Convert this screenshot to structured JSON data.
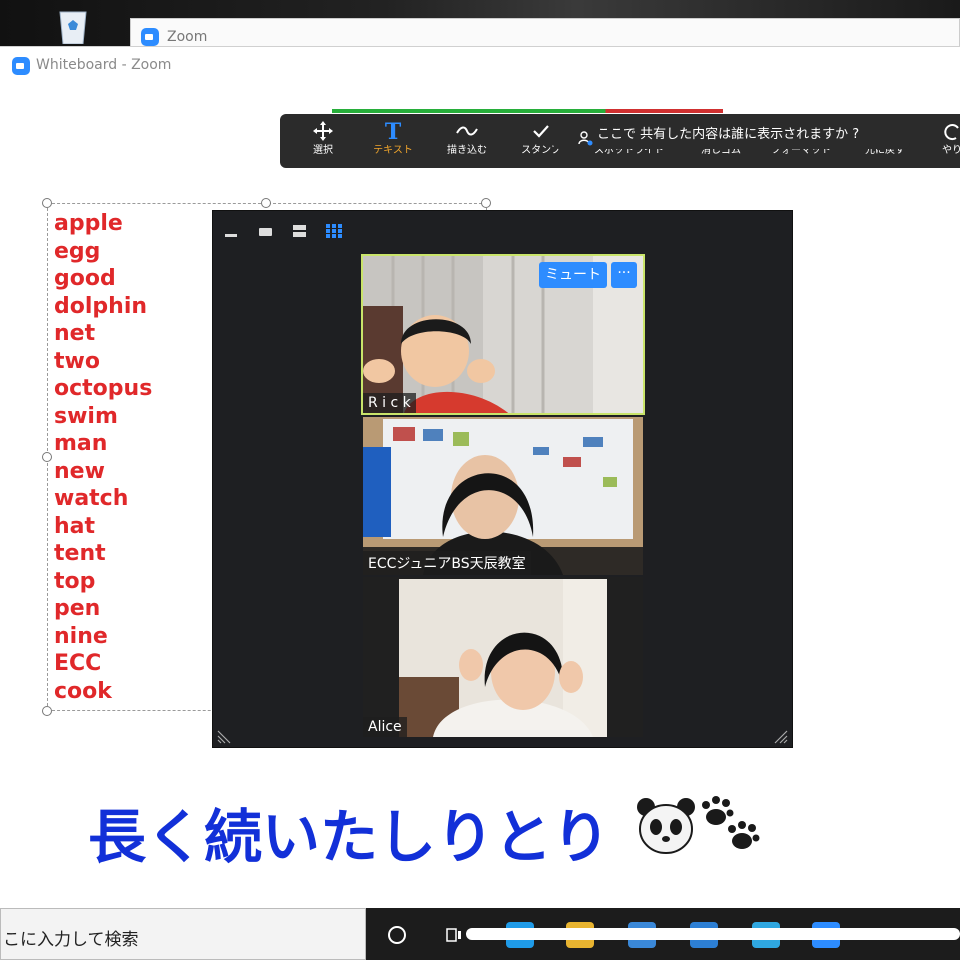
{
  "desktop": {
    "zoom_window_title": "Zoom"
  },
  "window": {
    "title": "Whiteboard - Zoom"
  },
  "toolbar": {
    "tools": [
      {
        "icon": "move-arrows-icon",
        "label": "選択"
      },
      {
        "icon": "text-t-icon",
        "label": "テキスト",
        "active": true
      },
      {
        "icon": "draw-squiggle-icon",
        "label": "描き込む"
      },
      {
        "icon": "stamp-check-icon",
        "label": "スタンプ"
      },
      {
        "icon": "spotlight-wand-icon",
        "label": "スポットライト"
      },
      {
        "icon": "eraser-icon",
        "label": "消しゴム"
      },
      {
        "icon": "format-color-icon",
        "label": "フォーマット"
      },
      {
        "icon": "undo-icon",
        "label": "元に戻す"
      },
      {
        "icon": "redo-icon",
        "label": "やり"
      }
    ],
    "share_tip": "ここで 共有した内容は誰に表示されますか ?",
    "accent_colors": {
      "active": "#f0a52c",
      "format": "#ff1e1e",
      "green_bar": "#27ae3a",
      "red_bar": "#d03030"
    }
  },
  "words": [
    "apple",
    "egg",
    "good",
    "dolphin",
    "net",
    "two",
    "octopus",
    "swim",
    "man",
    "new",
    "watch",
    "hat",
    "tent",
    "top",
    "pen",
    "nine",
    "ECC",
    "cook"
  ],
  "word_color": "#e0282a",
  "video_panel": {
    "tiles": [
      {
        "name": "R i c k",
        "active_speaker": true
      },
      {
        "name": "ECCジュニアBS天辰教室"
      },
      {
        "name": "Alice"
      }
    ],
    "mute_label": "ミュート",
    "more_label": "···"
  },
  "caption": {
    "text": "長く続いたしりとり",
    "emoji": "🐼🐾",
    "color": "#1230d8"
  },
  "taskbar": {
    "search_text": "こに入力して検索"
  }
}
